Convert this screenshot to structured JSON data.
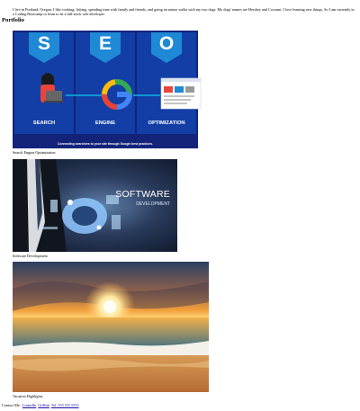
{
  "intro": "I live in Portland, Oregon. I like cooking, fishing, spending time with family and friends, and going on nature walks with my two dogs. My dogs' names are Hershey and Coconut. I love learning new things. So I am currently in a Coding Bootcamp to learn to be a full-stack web developer.",
  "portfolio": {
    "heading": "Portfolio",
    "items": [
      {
        "caption": "Search Engine Optimization",
        "image": {
          "letters": [
            "S",
            "E",
            "O"
          ],
          "panel_labels": [
            "SEARCH",
            "ENGINE",
            "OPTIMIZATION"
          ],
          "footer": "Connecting searchers to your site through Google best practices."
        }
      },
      {
        "caption": "Software Development",
        "image": {
          "title": "SOFTWARE",
          "subtitle": "DEVELOPMENT"
        }
      },
      {
        "caption": "Vacation Highlights"
      }
    ]
  },
  "contact": {
    "label": "Contact Me:",
    "links": [
      "LinkedIn",
      "GitHub",
      "Tel: 555.555.5555"
    ]
  }
}
